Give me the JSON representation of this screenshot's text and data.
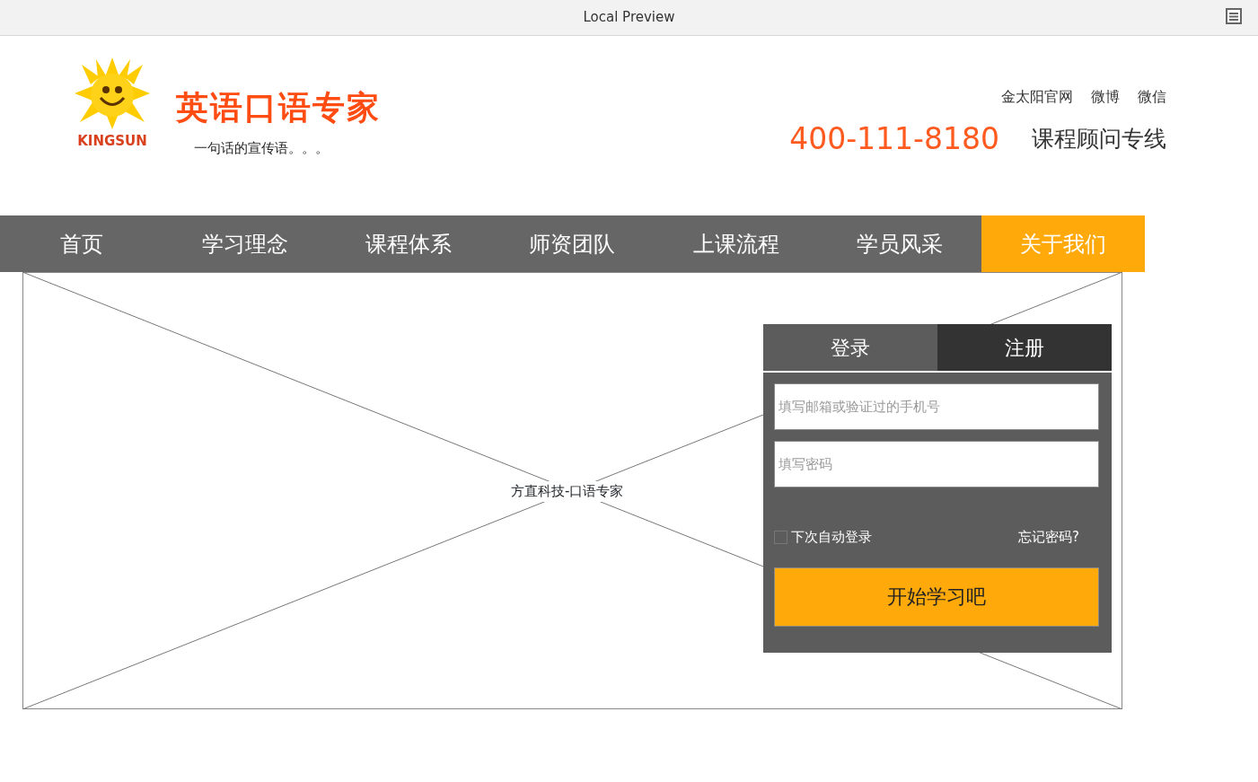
{
  "preview_bar": {
    "title": "Local Preview"
  },
  "header": {
    "logo_text": "KINGSUN",
    "brand": "英语口语专家",
    "slogan": "一句话的宣传语。。。",
    "top_links": [
      "金太阳官网",
      "微博",
      "微信"
    ],
    "phone": "400-111-8180",
    "phone_label": "课程顾问专线"
  },
  "nav": [
    {
      "label": "首页",
      "selected": false
    },
    {
      "label": "学习理念",
      "selected": false
    },
    {
      "label": "课程体系",
      "selected": false
    },
    {
      "label": "师资团队",
      "selected": false
    },
    {
      "label": "上课流程",
      "selected": false
    },
    {
      "label": "学员风采",
      "selected": false
    },
    {
      "label": "关于我们",
      "selected": true
    }
  ],
  "banner": {
    "caption": "方直科技-口语专家"
  },
  "login": {
    "tabs": [
      {
        "label": "登录",
        "selected": false
      },
      {
        "label": "注册",
        "selected": true
      }
    ],
    "fields": [
      {
        "placeholder": "填写邮箱或验证过的手机号"
      },
      {
        "placeholder": "填写密码"
      }
    ],
    "remember": {
      "label": "下次自动登录",
      "checked": false
    },
    "forgot": "忘记密码?",
    "submit": "开始学习吧"
  }
}
